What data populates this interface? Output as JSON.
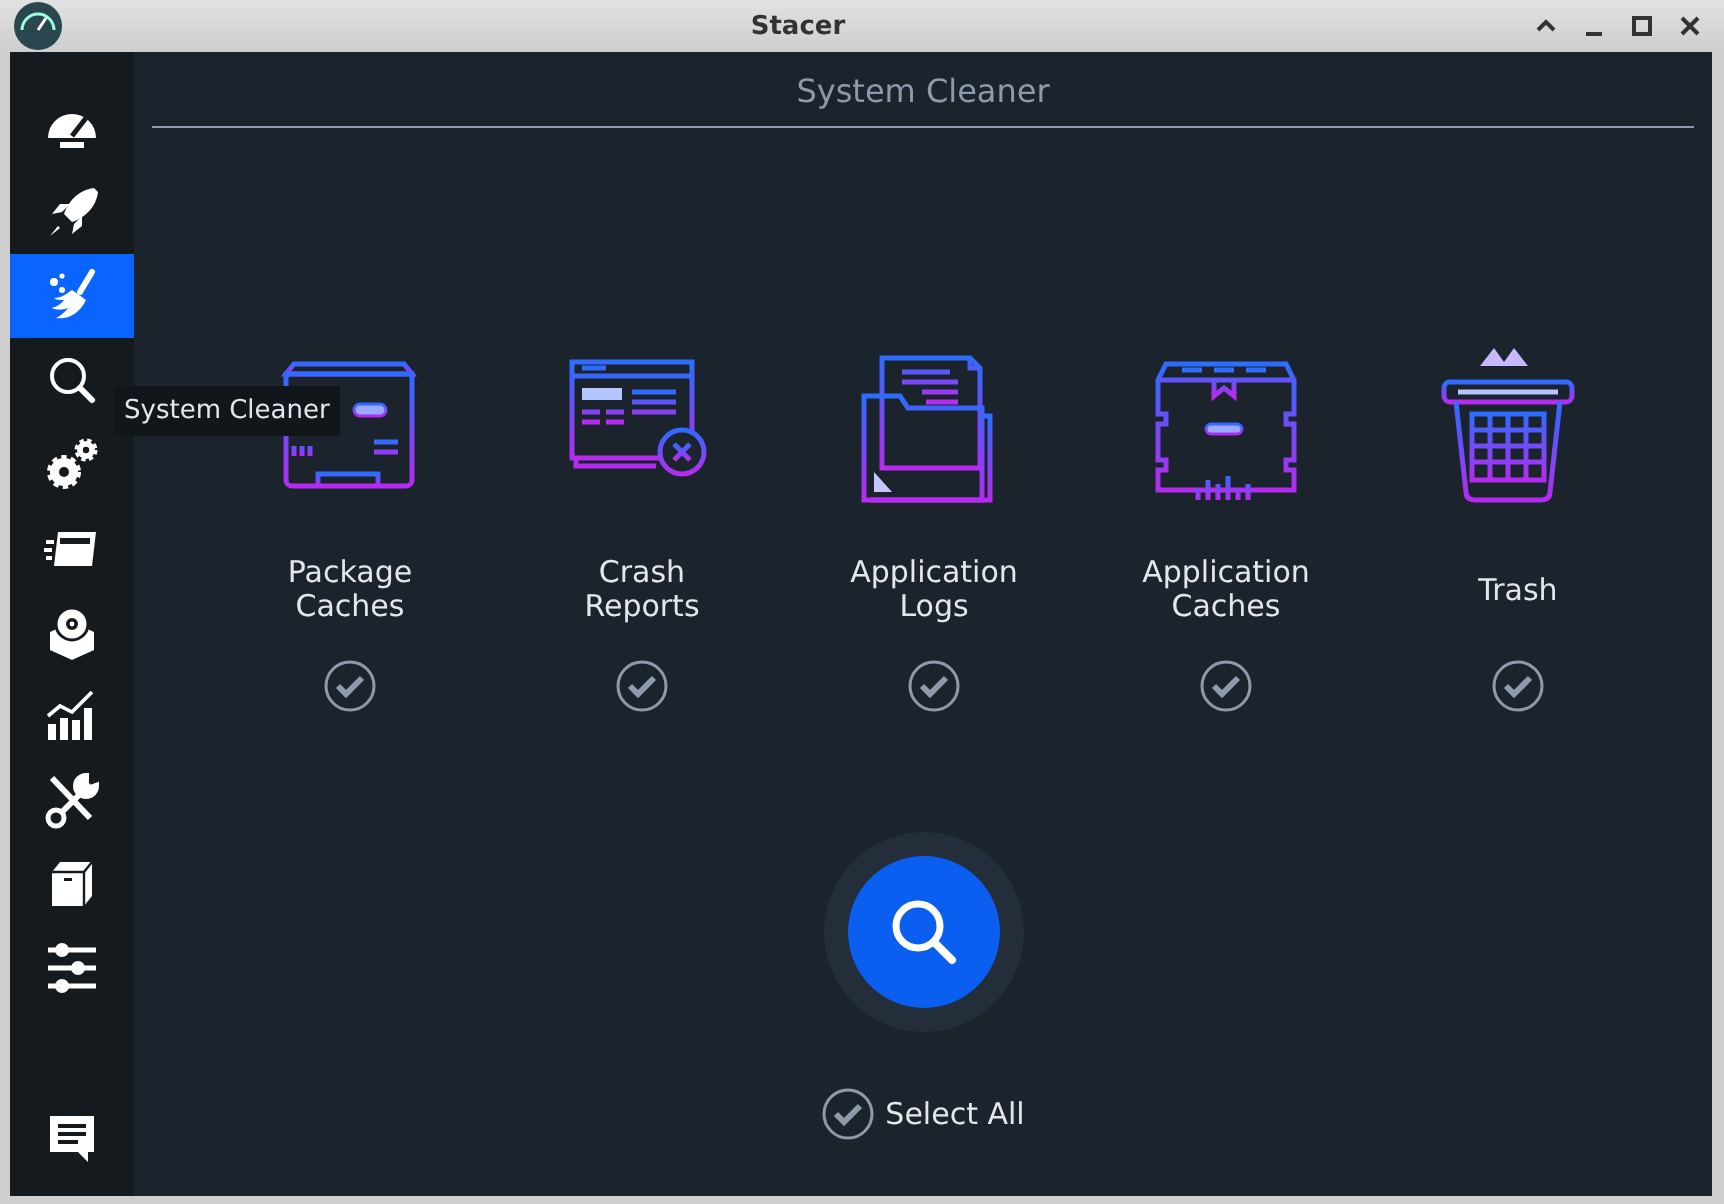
{
  "window": {
    "title": "Stacer"
  },
  "sidebar": {
    "items": [
      {
        "selected": false
      },
      {
        "selected": false
      },
      {
        "selected": true
      },
      {
        "selected": false
      },
      {
        "selected": false
      },
      {
        "selected": false
      },
      {
        "selected": false
      },
      {
        "selected": false
      },
      {
        "selected": false
      },
      {
        "selected": false
      },
      {
        "selected": false
      }
    ],
    "feedback": {
      "selected": false
    }
  },
  "tooltip": "System Cleaner",
  "page": {
    "title": "System Cleaner",
    "categories": [
      {
        "label": "Package\nCaches",
        "checked": true
      },
      {
        "label": "Crash\nReports",
        "checked": true
      },
      {
        "label": "Application\nLogs",
        "checked": true
      },
      {
        "label": "Application\nCaches",
        "checked": true
      },
      {
        "label": "Trash",
        "checked": true
      }
    ],
    "select_all": {
      "label": "Select All",
      "checked": true
    }
  }
}
